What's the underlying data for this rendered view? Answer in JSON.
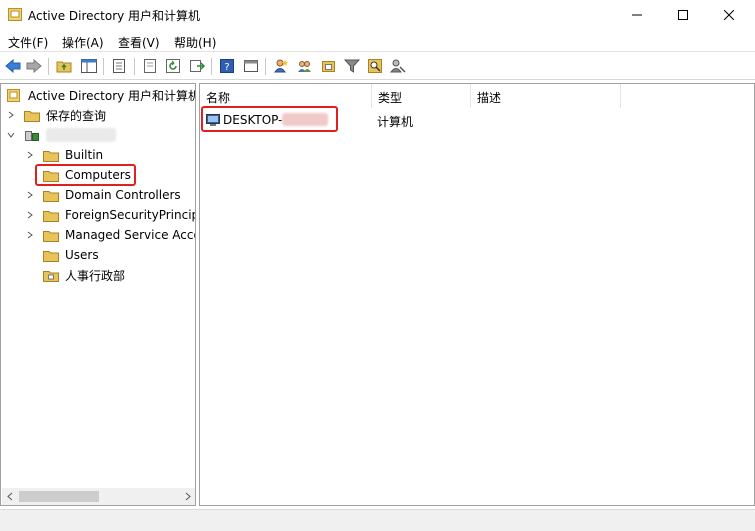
{
  "window": {
    "title": "Active Directory 用户和计算机",
    "controls": [
      "minimize",
      "maximize",
      "close"
    ]
  },
  "menu": {
    "items": [
      "文件(F)",
      "操作(A)",
      "查看(V)",
      "帮助(H)"
    ]
  },
  "toolbar": {
    "icons": [
      "back-arrow-icon",
      "forward-arrow-icon",
      "up-folder-icon",
      "show-console-tree-icon",
      "properties-icon",
      "export-list-icon",
      "refresh-icon",
      "export-icon",
      "help-icon",
      "console-icon",
      "add-user-icon",
      "add-group-icon",
      "add-ou-icon",
      "filter-icon",
      "find-icon",
      "delegate-icon"
    ]
  },
  "tree": {
    "root": "Active Directory 用户和计算机",
    "items": [
      {
        "label": "保存的查询",
        "level": 1,
        "expander": ">"
      },
      {
        "label": "",
        "level": 1,
        "expander": "v",
        "redacted": true
      },
      {
        "label": "Builtin",
        "level": 2,
        "expander": ">"
      },
      {
        "label": "Computers",
        "level": 2,
        "expander": "",
        "selected": true
      },
      {
        "label": "Domain Controllers",
        "level": 2,
        "expander": ">"
      },
      {
        "label": "ForeignSecurityPrincipals",
        "level": 2,
        "expander": ">"
      },
      {
        "label": "Managed Service Accounts",
        "level": 2,
        "expander": ">"
      },
      {
        "label": "Users",
        "level": 2,
        "expander": ""
      },
      {
        "label": "人事行政部",
        "level": 2,
        "expander": ""
      }
    ]
  },
  "list": {
    "columns": [
      "名称",
      "类型",
      "描述"
    ],
    "rows": [
      {
        "name": "DESKTOP-",
        "type": "计算机",
        "description": ""
      }
    ]
  },
  "colors": {
    "highlight": "#e02020",
    "folder": "#e8c35a"
  }
}
